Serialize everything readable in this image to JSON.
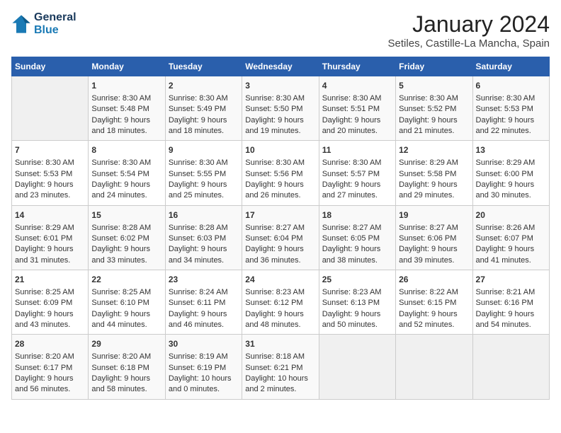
{
  "header": {
    "logo_line1": "General",
    "logo_line2": "Blue",
    "title": "January 2024",
    "subtitle": "Setiles, Castille-La Mancha, Spain"
  },
  "days_of_week": [
    "Sunday",
    "Monday",
    "Tuesday",
    "Wednesday",
    "Thursday",
    "Friday",
    "Saturday"
  ],
  "weeks": [
    [
      {
        "day": "",
        "data": ""
      },
      {
        "day": "1",
        "data": "Sunrise: 8:30 AM\nSunset: 5:48 PM\nDaylight: 9 hours\nand 18 minutes."
      },
      {
        "day": "2",
        "data": "Sunrise: 8:30 AM\nSunset: 5:49 PM\nDaylight: 9 hours\nand 18 minutes."
      },
      {
        "day": "3",
        "data": "Sunrise: 8:30 AM\nSunset: 5:50 PM\nDaylight: 9 hours\nand 19 minutes."
      },
      {
        "day": "4",
        "data": "Sunrise: 8:30 AM\nSunset: 5:51 PM\nDaylight: 9 hours\nand 20 minutes."
      },
      {
        "day": "5",
        "data": "Sunrise: 8:30 AM\nSunset: 5:52 PM\nDaylight: 9 hours\nand 21 minutes."
      },
      {
        "day": "6",
        "data": "Sunrise: 8:30 AM\nSunset: 5:53 PM\nDaylight: 9 hours\nand 22 minutes."
      }
    ],
    [
      {
        "day": "7",
        "data": "Sunrise: 8:30 AM\nSunset: 5:53 PM\nDaylight: 9 hours\nand 23 minutes."
      },
      {
        "day": "8",
        "data": "Sunrise: 8:30 AM\nSunset: 5:54 PM\nDaylight: 9 hours\nand 24 minutes."
      },
      {
        "day": "9",
        "data": "Sunrise: 8:30 AM\nSunset: 5:55 PM\nDaylight: 9 hours\nand 25 minutes."
      },
      {
        "day": "10",
        "data": "Sunrise: 8:30 AM\nSunset: 5:56 PM\nDaylight: 9 hours\nand 26 minutes."
      },
      {
        "day": "11",
        "data": "Sunrise: 8:30 AM\nSunset: 5:57 PM\nDaylight: 9 hours\nand 27 minutes."
      },
      {
        "day": "12",
        "data": "Sunrise: 8:29 AM\nSunset: 5:58 PM\nDaylight: 9 hours\nand 29 minutes."
      },
      {
        "day": "13",
        "data": "Sunrise: 8:29 AM\nSunset: 6:00 PM\nDaylight: 9 hours\nand 30 minutes."
      }
    ],
    [
      {
        "day": "14",
        "data": "Sunrise: 8:29 AM\nSunset: 6:01 PM\nDaylight: 9 hours\nand 31 minutes."
      },
      {
        "day": "15",
        "data": "Sunrise: 8:28 AM\nSunset: 6:02 PM\nDaylight: 9 hours\nand 33 minutes."
      },
      {
        "day": "16",
        "data": "Sunrise: 8:28 AM\nSunset: 6:03 PM\nDaylight: 9 hours\nand 34 minutes."
      },
      {
        "day": "17",
        "data": "Sunrise: 8:27 AM\nSunset: 6:04 PM\nDaylight: 9 hours\nand 36 minutes."
      },
      {
        "day": "18",
        "data": "Sunrise: 8:27 AM\nSunset: 6:05 PM\nDaylight: 9 hours\nand 38 minutes."
      },
      {
        "day": "19",
        "data": "Sunrise: 8:27 AM\nSunset: 6:06 PM\nDaylight: 9 hours\nand 39 minutes."
      },
      {
        "day": "20",
        "data": "Sunrise: 8:26 AM\nSunset: 6:07 PM\nDaylight: 9 hours\nand 41 minutes."
      }
    ],
    [
      {
        "day": "21",
        "data": "Sunrise: 8:25 AM\nSunset: 6:09 PM\nDaylight: 9 hours\nand 43 minutes."
      },
      {
        "day": "22",
        "data": "Sunrise: 8:25 AM\nSunset: 6:10 PM\nDaylight: 9 hours\nand 44 minutes."
      },
      {
        "day": "23",
        "data": "Sunrise: 8:24 AM\nSunset: 6:11 PM\nDaylight: 9 hours\nand 46 minutes."
      },
      {
        "day": "24",
        "data": "Sunrise: 8:23 AM\nSunset: 6:12 PM\nDaylight: 9 hours\nand 48 minutes."
      },
      {
        "day": "25",
        "data": "Sunrise: 8:23 AM\nSunset: 6:13 PM\nDaylight: 9 hours\nand 50 minutes."
      },
      {
        "day": "26",
        "data": "Sunrise: 8:22 AM\nSunset: 6:15 PM\nDaylight: 9 hours\nand 52 minutes."
      },
      {
        "day": "27",
        "data": "Sunrise: 8:21 AM\nSunset: 6:16 PM\nDaylight: 9 hours\nand 54 minutes."
      }
    ],
    [
      {
        "day": "28",
        "data": "Sunrise: 8:20 AM\nSunset: 6:17 PM\nDaylight: 9 hours\nand 56 minutes."
      },
      {
        "day": "29",
        "data": "Sunrise: 8:20 AM\nSunset: 6:18 PM\nDaylight: 9 hours\nand 58 minutes."
      },
      {
        "day": "30",
        "data": "Sunrise: 8:19 AM\nSunset: 6:19 PM\nDaylight: 10 hours\nand 0 minutes."
      },
      {
        "day": "31",
        "data": "Sunrise: 8:18 AM\nSunset: 6:21 PM\nDaylight: 10 hours\nand 2 minutes."
      },
      {
        "day": "",
        "data": ""
      },
      {
        "day": "",
        "data": ""
      },
      {
        "day": "",
        "data": ""
      }
    ]
  ]
}
